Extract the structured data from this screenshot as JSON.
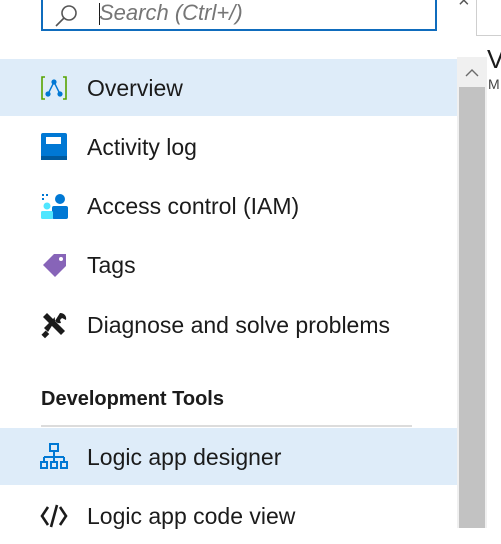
{
  "search": {
    "placeholder": "Search (Ctrl+/)"
  },
  "nav": {
    "items": [
      {
        "label": "Overview",
        "icon": "overview-icon",
        "selected": true
      },
      {
        "label": "Activity log",
        "icon": "activity-log-icon"
      },
      {
        "label": "Access control (IAM)",
        "icon": "access-control-icon"
      },
      {
        "label": "Tags",
        "icon": "tag-icon"
      },
      {
        "label": "Diagnose and solve problems",
        "icon": "wrench-icon"
      }
    ],
    "sections": [
      {
        "header": "Development Tools",
        "items": [
          {
            "label": "Logic app designer",
            "icon": "logic-app-designer-icon",
            "hover": true
          },
          {
            "label": "Logic app code view",
            "icon": "code-view-icon"
          }
        ]
      }
    ]
  },
  "right_panel": {
    "letter_large": "V",
    "letter_small": "M"
  },
  "colors": {
    "accent": "#0f6cbd",
    "selected_bg": "#deecf9",
    "tag_purple": "#8764b8",
    "activity_blue": "#0078d4",
    "overview_green": "#57a300"
  }
}
